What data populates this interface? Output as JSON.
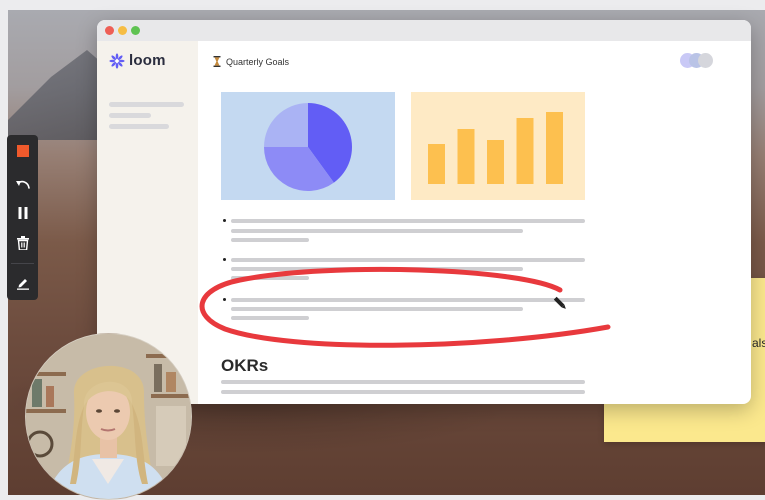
{
  "app": {
    "logo_text": "loom",
    "logo_icon": "loom-flower-icon",
    "brand_color": "#625df5"
  },
  "document": {
    "title": "Quarterly Goals",
    "icon": "hourglass-icon",
    "section_heading": "OKRs"
  },
  "charts": [
    {
      "chart_data": {
        "type": "pie",
        "slices": [
          {
            "value": 40,
            "color": "#625df5"
          },
          {
            "value": 35,
            "color": "#8d8bf6"
          },
          {
            "value": 25,
            "color": "#aab3f4"
          }
        ]
      }
    },
    {
      "chart_data": {
        "type": "bar",
        "values": [
          40,
          55,
          44,
          66,
          72
        ],
        "ylim": [
          0,
          80
        ],
        "color": "#fdc04f"
      }
    }
  ],
  "desktop": {
    "sticky_note_text": "als",
    "sticky_color": "#fbe88d"
  },
  "recording_toolbar": {
    "buttons": [
      {
        "name": "stop-recording-button",
        "icon": "stop-icon"
      },
      {
        "name": "restart-button",
        "icon": "restart-icon"
      },
      {
        "name": "pause-button",
        "icon": "pause-icon"
      },
      {
        "name": "delete-button",
        "icon": "trash-icon"
      },
      {
        "name": "draw-button",
        "icon": "pencil-icon"
      }
    ]
  },
  "annotation": {
    "color": "#e8393d",
    "tool_icon": "pen-cursor-icon"
  },
  "camera_bubble": {
    "description": "webcam-bubble"
  }
}
